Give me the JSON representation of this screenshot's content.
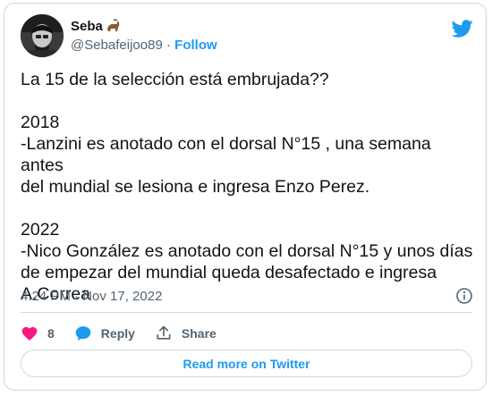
{
  "author": {
    "name": "Seba",
    "name_emoji": "goat-emoji",
    "handle": "@Sebafeijoo89",
    "separator": " · ",
    "follow_label": "Follow",
    "avatar_icon": "profile-photo"
  },
  "brand": {
    "icon": "twitter-bird-icon",
    "color": "#1d9bf0"
  },
  "tweet": {
    "line1": "La 15 de la selección está embrujada??",
    "year1": "2018",
    "para1a": "-Lanzini es anotado con el dorsal N°15 , una semana antes",
    "para1b": "del mundial se lesiona e ingresa Enzo Perez.",
    "year2": "2022",
    "para2a": "-Nico González es anotado con el dorsal N°15 y unos días",
    "para2b": "de empezar del mundial queda desafectado e ingresa",
    "para2c": "A.Correa"
  },
  "meta": {
    "timestamp": "4:24 PM · Nov 17, 2022",
    "info_icon": "info-icon"
  },
  "actions": {
    "like_count": "8",
    "like_color": "#f91880",
    "reply_label": "Reply",
    "share_label": "Share"
  },
  "read_more_label": "Read more on Twitter"
}
